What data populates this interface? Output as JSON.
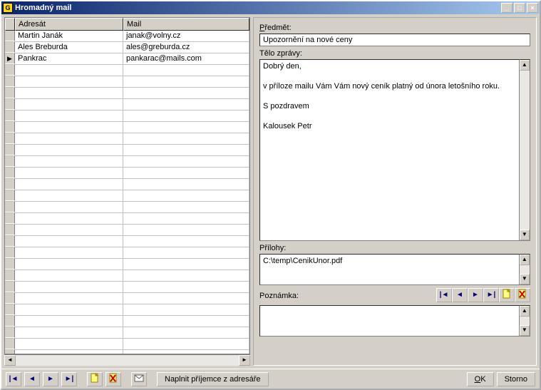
{
  "window": {
    "title": "Hromadný mail",
    "app_icon_letter": "G"
  },
  "grid": {
    "headers": {
      "name": "Adresát",
      "mail": "Mail"
    },
    "rows": [
      {
        "name": "Martin Janák",
        "mail": "janak@volny.cz",
        "current": false
      },
      {
        "name": "Ales Breburda",
        "mail": "ales@greburda.cz",
        "current": false
      },
      {
        "name": "Pankrac",
        "mail": "pankarac@mails.com",
        "current": true
      }
    ],
    "empty_rows": 27
  },
  "form": {
    "subject_label": "Předmět:",
    "subject_value": "Upozornění na nové ceny",
    "body_label": "Tělo zprávy:",
    "body_value": "Dobrý den,\n\nv příloze mailu Vám Vám nový ceník platný od února letošního roku.\n\nS pozdravem\n\nKalousek Petr",
    "attach_label": "Přílohy:",
    "attach_value": "C:\\temp\\CenikUnor.pdf",
    "note_label": "Poznámka:",
    "note_value": ""
  },
  "nav_icons": {
    "first": "|◄",
    "prev": "◄",
    "next": "►",
    "last": "►|"
  },
  "bottom": {
    "fill_button": "Naplnit příjemce z adresáře",
    "ok": "OK",
    "cancel": "Storno"
  },
  "titlebar_buttons": {
    "min": "_",
    "max": "□",
    "close": "×"
  }
}
